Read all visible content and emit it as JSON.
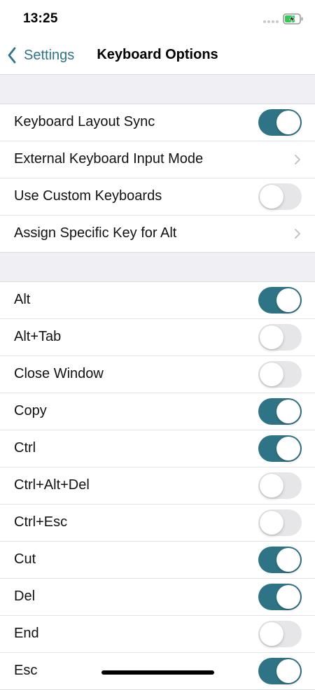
{
  "status_bar": {
    "time": "13:25"
  },
  "nav": {
    "back_label": "Settings",
    "title": "Keyboard Options"
  },
  "colors": {
    "accent": "#2f7486",
    "toggle_off": "#e6e6e8",
    "group_bg": "#efeff4"
  },
  "section1": {
    "rows": [
      {
        "label": "Keyboard Layout Sync",
        "type": "toggle",
        "on": true
      },
      {
        "label": "External Keyboard Input Mode",
        "type": "disclosure"
      },
      {
        "label": "Use Custom Keyboards",
        "type": "toggle",
        "on": false
      },
      {
        "label": "Assign Specific Key for Alt",
        "type": "disclosure"
      }
    ]
  },
  "section2": {
    "rows": [
      {
        "label": "Alt",
        "type": "toggle",
        "on": true
      },
      {
        "label": "Alt+Tab",
        "type": "toggle",
        "on": false
      },
      {
        "label": "Close Window",
        "type": "toggle",
        "on": false
      },
      {
        "label": "Copy",
        "type": "toggle",
        "on": true
      },
      {
        "label": "Ctrl",
        "type": "toggle",
        "on": true
      },
      {
        "label": "Ctrl+Alt+Del",
        "type": "toggle",
        "on": false
      },
      {
        "label": "Ctrl+Esc",
        "type": "toggle",
        "on": false
      },
      {
        "label": "Cut",
        "type": "toggle",
        "on": true
      },
      {
        "label": "Del",
        "type": "toggle",
        "on": true
      },
      {
        "label": "End",
        "type": "toggle",
        "on": false
      },
      {
        "label": "Esc",
        "type": "toggle",
        "on": true
      }
    ]
  }
}
